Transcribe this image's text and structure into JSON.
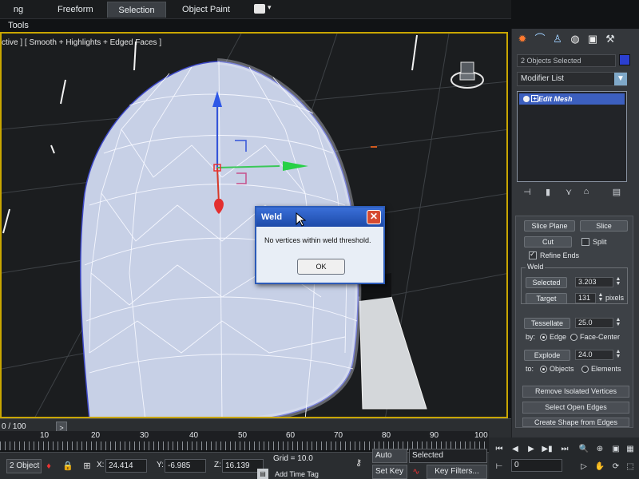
{
  "tabs": [
    {
      "label": "ng Tools",
      "active": false
    },
    {
      "label": "Freeform",
      "active": false
    },
    {
      "label": "Selection",
      "active": true
    },
    {
      "label": "Object Paint",
      "active": false
    }
  ],
  "viewport": {
    "label": "ctive ] [ Smooth + Highlights + Edged Faces ]"
  },
  "dialog": {
    "title": "Weld",
    "message": "No vertices within weld threshold.",
    "ok_label": "OK",
    "close_label": "✕"
  },
  "panel": {
    "objects_selected": "2 Objects Selected",
    "object_color": "#2b3fd0",
    "modifier_list_label": "Modifier List",
    "stack_item": "Edit Mesh",
    "slice_plane_label": "Slice Plane",
    "slice_label": "Slice",
    "cut_label": "Cut",
    "split_label": "Split",
    "split_checked": false,
    "refine_ends_label": "Refine Ends",
    "refine_ends_checked": true,
    "weld_group_label": "Weld",
    "weld_selected_label": "Selected",
    "weld_selected_value": "3.203",
    "weld_target_label": "Target",
    "weld_target_value": "131",
    "weld_target_unit": "pixels",
    "tessellate_label": "Tessellate",
    "tessellate_value": "25.0",
    "by_label": "by:",
    "edge_label": "Edge",
    "face_center_label": "Face-Center",
    "explode_label": "Explode",
    "explode_value": "24.0",
    "to_label": "to:",
    "objects_label": "Objects",
    "elements_label": "Elements",
    "remove_isolated_label": "Remove Isolated Vertices",
    "select_open_edges_label": "Select Open Edges",
    "create_shape_label": "Create Shape from Edges"
  },
  "timeline": {
    "frame_counter": "0 / 100",
    "next_label": ">",
    "tick_labels": [
      "10",
      "20",
      "30",
      "40",
      "50",
      "60",
      "70",
      "80",
      "90",
      "100"
    ]
  },
  "status": {
    "objects_selected": "2 Object",
    "x_label": "X:",
    "x_value": "24.414",
    "y_label": "Y:",
    "y_value": "-6.985",
    "z_label": "Z:",
    "z_value": "16.139",
    "grid_label": "Grid = 10.0",
    "add_time_tag": "Add Time Tag",
    "auto_key_label": "Auto Key",
    "auto_key_value": "Selected",
    "set_key_label": "Set Key",
    "key_filters_label": "Key Filters...",
    "current_frame": "0"
  },
  "icons": {
    "create": "sun-icon",
    "modify": "curve-icon",
    "hierarchy": "hierarchy-icon",
    "motion": "motion-icon",
    "display": "display-icon",
    "utilities": "hammer-icon"
  }
}
